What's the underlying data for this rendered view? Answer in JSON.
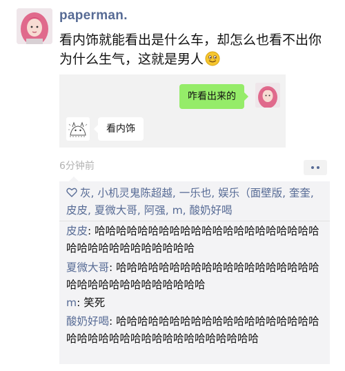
{
  "post": {
    "username": "paperman.",
    "text": "看内饰就能看出是什么车，却怎么也看不出你为什么生气，这就是男人",
    "emoji": "smile-emoji",
    "time": "6分钟前"
  },
  "quote": {
    "right_message": "咋看出来的",
    "left_message": "看内饰"
  },
  "likes": {
    "icon": "heart-icon",
    "names": "灰, 小机灵鬼陈超越, 一乐也, 娱乐（面壁版, 奎奎, 皮皮, 夏微大哥, 阿强, m, 酸奶好喝"
  },
  "comments": [
    {
      "name": "皮皮",
      "sep": ": ",
      "text": "哈哈哈哈哈哈哈哈哈哈哈哈哈哈哈哈哈哈哈哈哈哈哈哈哈哈哈哈哈哈哈哈哈"
    },
    {
      "name": "夏微大哥",
      "sep": ": ",
      "text": "哈哈哈哈哈哈哈哈哈哈哈哈哈哈哈哈哈哈哈哈哈哈哈哈哈哈哈哈哈哈哈哈"
    },
    {
      "name": "m",
      "sep": ": ",
      "text": "笑死"
    },
    {
      "name": "酸奶好喝",
      "sep": ": ",
      "text": "哈哈哈哈哈哈哈哈哈哈哈哈哈哈哈哈哈哈哈哈哈哈哈哈哈哈哈哈哈哈哈哈哈哈哈哈哈"
    }
  ],
  "colors": {
    "name_link": "#576b95",
    "bubble_green": "#95ec69",
    "panel_bg": "#f3f3f5"
  }
}
